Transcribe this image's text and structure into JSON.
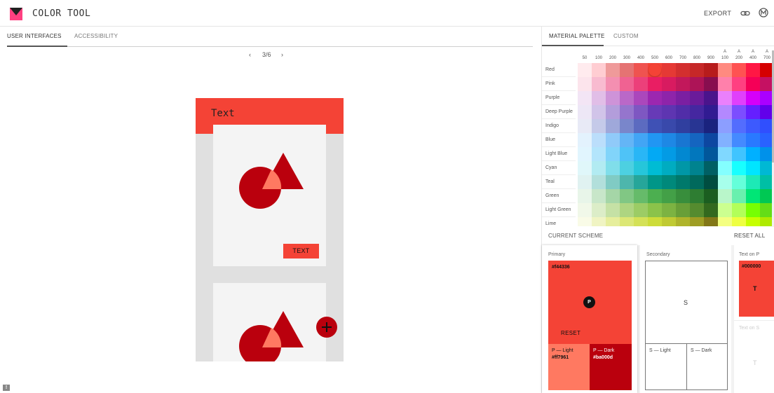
{
  "app": {
    "title": "COLOR TOOL",
    "export_label": "EXPORT"
  },
  "left_tabs": [
    "USER INTERFACES",
    "ACCESSIBILITY"
  ],
  "pager": {
    "prev": "‹",
    "count": "3/6",
    "next": "›"
  },
  "preview": {
    "appbar_text": "Text",
    "button_label": "TEXT"
  },
  "right_tabs": [
    "MATERIAL PALETTE",
    "CUSTOM"
  ],
  "palette": {
    "shade_headers": [
      {
        "l1": "",
        "l2": "50"
      },
      {
        "l1": "",
        "l2": "100"
      },
      {
        "l1": "",
        "l2": "200"
      },
      {
        "l1": "",
        "l2": "300"
      },
      {
        "l1": "",
        "l2": "400"
      },
      {
        "l1": "",
        "l2": "500"
      },
      {
        "l1": "",
        "l2": "600"
      },
      {
        "l1": "",
        "l2": "700"
      },
      {
        "l1": "",
        "l2": "800"
      },
      {
        "l1": "",
        "l2": "900"
      },
      {
        "l1": "A",
        "l2": "100"
      },
      {
        "l1": "A",
        "l2": "200"
      },
      {
        "l1": "A",
        "l2": "400"
      },
      {
        "l1": "A",
        "l2": "700"
      }
    ],
    "selected": {
      "row": 0,
      "col": 5
    },
    "rows": [
      {
        "name": "Red",
        "colors": [
          "#ffebee",
          "#ffcdd2",
          "#ef9a9a",
          "#e57373",
          "#ef5350",
          "#f44336",
          "#e53935",
          "#d32f2f",
          "#c62828",
          "#b71c1c",
          "#ff8a80",
          "#ff5252",
          "#ff1744",
          "#d50000"
        ]
      },
      {
        "name": "Pink",
        "colors": [
          "#fce4ec",
          "#f8bbd0",
          "#f48fb1",
          "#f06292",
          "#ec407a",
          "#e91e63",
          "#d81b60",
          "#c2185b",
          "#ad1457",
          "#880e4f",
          "#ff80ab",
          "#ff4081",
          "#f50057",
          "#c51162"
        ]
      },
      {
        "name": "Purple",
        "colors": [
          "#f3e5f5",
          "#e1bee7",
          "#ce93d8",
          "#ba68c8",
          "#ab47bc",
          "#9c27b0",
          "#8e24aa",
          "#7b1fa2",
          "#6a1b9a",
          "#4a148c",
          "#ea80fc",
          "#e040fb",
          "#d500f9",
          "#aa00ff"
        ]
      },
      {
        "name": "Deep Purple",
        "colors": [
          "#ede7f6",
          "#d1c4e9",
          "#b39ddb",
          "#9575cd",
          "#7e57c2",
          "#673ab7",
          "#5e35b1",
          "#512da8",
          "#4527a0",
          "#311b92",
          "#b388ff",
          "#7c4dff",
          "#651fff",
          "#6200ea"
        ]
      },
      {
        "name": "Indigo",
        "colors": [
          "#e8eaf6",
          "#c5cae9",
          "#9fa8da",
          "#7986cb",
          "#5c6bc0",
          "#3f51b5",
          "#3949ab",
          "#303f9f",
          "#283593",
          "#1a237e",
          "#8c9eff",
          "#536dfe",
          "#3d5afe",
          "#304ffe"
        ]
      },
      {
        "name": "Blue",
        "colors": [
          "#e3f2fd",
          "#bbdefb",
          "#90caf9",
          "#64b5f6",
          "#42a5f5",
          "#2196f3",
          "#1e88e5",
          "#1976d2",
          "#1565c0",
          "#0d47a1",
          "#82b1ff",
          "#448aff",
          "#2979ff",
          "#2962ff"
        ]
      },
      {
        "name": "Light Blue",
        "colors": [
          "#e1f5fe",
          "#b3e5fc",
          "#81d4fa",
          "#4fc3f7",
          "#29b6f6",
          "#03a9f4",
          "#039be5",
          "#0288d1",
          "#0277bd",
          "#01579b",
          "#80d8ff",
          "#40c4ff",
          "#00b0ff",
          "#0091ea"
        ]
      },
      {
        "name": "Cyan",
        "colors": [
          "#e0f7fa",
          "#b2ebf2",
          "#80deea",
          "#4dd0e1",
          "#26c6da",
          "#00bcd4",
          "#00acc1",
          "#0097a7",
          "#00838f",
          "#006064",
          "#84ffff",
          "#18ffff",
          "#00e5ff",
          "#00b8d4"
        ]
      },
      {
        "name": "Teal",
        "colors": [
          "#e0f2f1",
          "#b2dfdb",
          "#80cbc4",
          "#4db6ac",
          "#26a69a",
          "#009688",
          "#00897b",
          "#00796b",
          "#00695c",
          "#004d40",
          "#a7ffeb",
          "#64ffda",
          "#1de9b6",
          "#00bfa5"
        ]
      },
      {
        "name": "Green",
        "colors": [
          "#e8f5e9",
          "#c8e6c9",
          "#a5d6a7",
          "#81c784",
          "#66bb6a",
          "#4caf50",
          "#43a047",
          "#388e3c",
          "#2e7d32",
          "#1b5e20",
          "#b9f6ca",
          "#69f0ae",
          "#00e676",
          "#00c853"
        ]
      },
      {
        "name": "Light Green",
        "colors": [
          "#f1f8e9",
          "#dcedc8",
          "#c5e1a5",
          "#aed581",
          "#9ccc65",
          "#8bc34a",
          "#7cb342",
          "#689f38",
          "#558b2f",
          "#33691e",
          "#ccff90",
          "#b2ff59",
          "#76ff03",
          "#64dd17"
        ]
      },
      {
        "name": "Lime",
        "colors": [
          "#f9fbe7",
          "#f0f4c3",
          "#e6ee9c",
          "#dce775",
          "#d4e157",
          "#cddc39",
          "#c0ca33",
          "#afb42b",
          "#9e9d24",
          "#827717",
          "#f4ff81",
          "#eeff41",
          "#c6ff00",
          "#aeea00"
        ]
      }
    ]
  },
  "scheme": {
    "title": "CURRENT SCHEME",
    "reset_all": "RESET ALL",
    "primary": {
      "label": "Primary",
      "hex": "#f44336",
      "badge": "P",
      "reset": "RESET",
      "light_label": "P — Light",
      "light_hex": "#ff7961",
      "dark_label": "P — Dark",
      "dark_hex": "#ba000d"
    },
    "secondary": {
      "label": "Secondary",
      "letter": "S",
      "light_label": "S — Light",
      "dark_label": "S — Dark"
    },
    "text_on_p": {
      "label": "Text on P",
      "hex": "#000000",
      "letter": "T"
    },
    "text_on_s": {
      "label": "Text on S",
      "letter": "T"
    }
  },
  "colors": {
    "primary": "#f44336",
    "primary_light": "#ff7961",
    "primary_dark": "#ba000d"
  }
}
